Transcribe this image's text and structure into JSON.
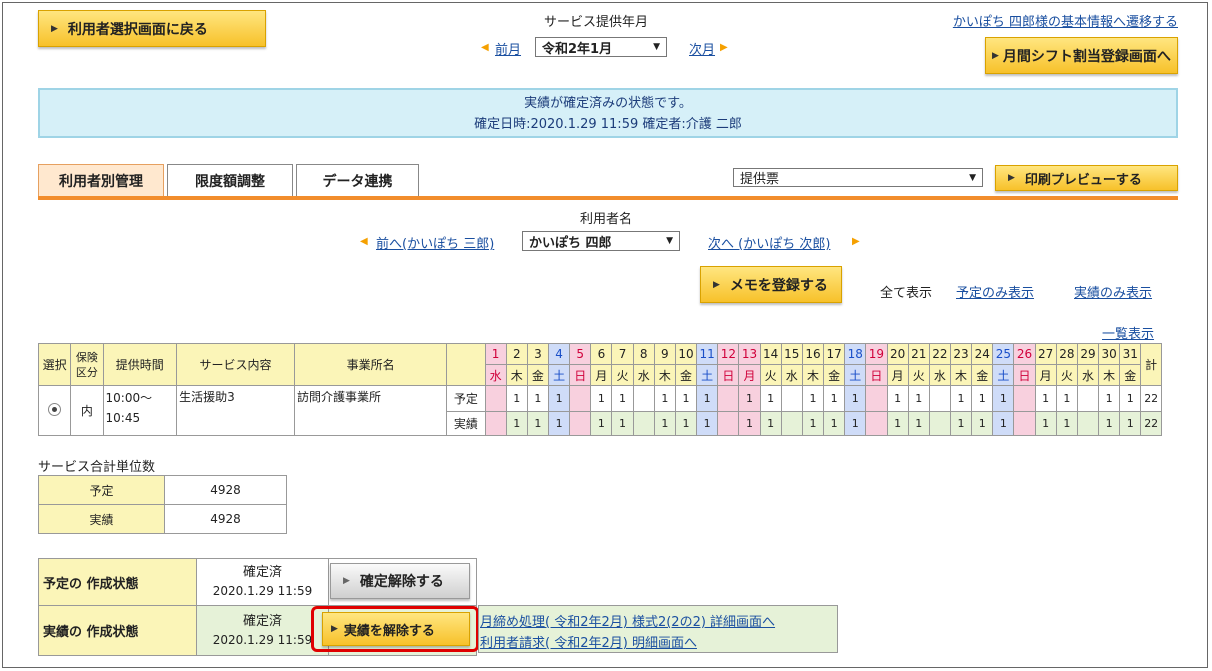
{
  "top": {
    "back_button": "利用者選択画面に戻る",
    "service_month_label": "サービス提供年月",
    "prev_month": "前月",
    "month_value": "令和2年1月",
    "next_month": "次月",
    "basic_info_link": "かいぽち 四郎様の基本情報へ遷移する",
    "shift_button": "月間シフト割当登録画面へ"
  },
  "info": {
    "line1": "実績が確定済みの状態です。",
    "line2": "確定日時:2020.1.29 11:59  確定者:介護 二郎"
  },
  "tabs": [
    "利用者別管理",
    "限度額調整",
    "データ連携"
  ],
  "print": {
    "select_value": "提供票",
    "preview_button": "印刷プレビューする"
  },
  "user": {
    "label": "利用者名",
    "prev_link": "前へ(かいぽち 三郎)",
    "select_value": "かいぽち 四郎",
    "next_link": "次へ (かいぽち 次郎)"
  },
  "memo_button": "メモを登録する",
  "filters": {
    "all": "全て表示",
    "plan_only": "予定のみ表示",
    "actual_only": "実績のみ表示"
  },
  "list_link": "一覧表示",
  "table": {
    "headers": {
      "select": "選択",
      "insurance": "保険区分",
      "time": "提供時間",
      "service": "サービス内容",
      "office": "事業所名",
      "total": "計"
    },
    "days": [
      "1",
      "2",
      "3",
      "4",
      "5",
      "6",
      "7",
      "8",
      "9",
      "10",
      "11",
      "12",
      "13",
      "14",
      "15",
      "16",
      "17",
      "18",
      "19",
      "20",
      "21",
      "22",
      "23",
      "24",
      "25",
      "26",
      "27",
      "28",
      "29",
      "30",
      "31"
    ],
    "dows": [
      "水",
      "木",
      "金",
      "土",
      "日",
      "月",
      "火",
      "水",
      "木",
      "金",
      "土",
      "日",
      "月",
      "火",
      "水",
      "木",
      "金",
      "土",
      "日",
      "月",
      "火",
      "水",
      "木",
      "金",
      "土",
      "日",
      "月",
      "火",
      "水",
      "木",
      "金"
    ],
    "day_types": [
      "hol",
      "w",
      "w",
      "sat",
      "sun",
      "w",
      "w",
      "w",
      "w",
      "w",
      "sat",
      "sun",
      "hol",
      "w",
      "w",
      "w",
      "w",
      "sat",
      "hol",
      "w",
      "w",
      "w",
      "w",
      "w",
      "sat",
      "sun",
      "w",
      "w",
      "w",
      "w",
      "w"
    ],
    "row": {
      "insurance": "内",
      "time_line1": "10:00～",
      "time_line2": "10:45",
      "service": "生活援助3",
      "office": "訪問介護事業所",
      "plan_label": "予定",
      "actual_label": "実績",
      "plan": [
        "",
        "1",
        "1",
        "1",
        "",
        "1",
        "1",
        "",
        "1",
        "1",
        "1",
        "",
        "1",
        "1",
        "",
        "1",
        "1",
        "1",
        "",
        "1",
        "1",
        "",
        "1",
        "1",
        "1",
        "",
        "1",
        "1",
        "",
        "1",
        "1"
      ],
      "actual": [
        "",
        "1",
        "1",
        "1",
        "",
        "1",
        "1",
        "",
        "1",
        "1",
        "1",
        "",
        "1",
        "1",
        "",
        "1",
        "1",
        "1",
        "",
        "1",
        "1",
        "",
        "1",
        "1",
        "1",
        "",
        "1",
        "1",
        "",
        "1",
        "1"
      ],
      "plan_total": "22",
      "actual_total": "22"
    }
  },
  "summary": {
    "title": "サービス合計単位数",
    "rows": [
      {
        "label": "予定",
        "value": "4928"
      },
      {
        "label": "実績",
        "value": "4928"
      }
    ]
  },
  "status": {
    "plan_label": "予定の 作成状態",
    "plan_state": "確定済",
    "plan_date": "2020.1.29 11:59",
    "plan_button": "確定解除する",
    "actual_label": "実績の 作成状態",
    "actual_state": "確定済",
    "actual_date": "2020.1.29 11:59",
    "actual_button": "実績を解除する",
    "link1": "月締め処理( 令和2年2月) 様式2(2の2) 詳細画面へ",
    "link2": "利用者請求( 令和2年2月) 明細画面へ"
  }
}
